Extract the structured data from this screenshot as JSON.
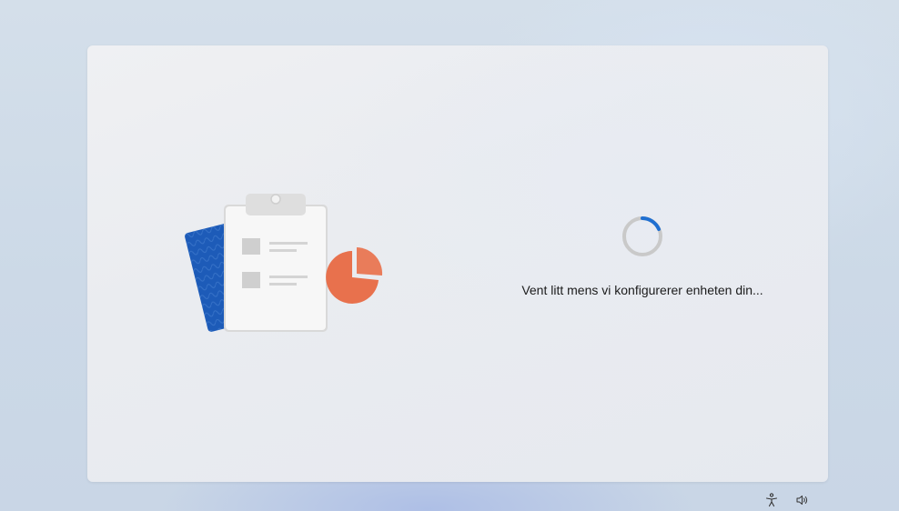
{
  "setup": {
    "status_message": "Vent litt mens vi konfigurerer enheten din..."
  },
  "illustration": {
    "items": [
      "notebook-icon",
      "clipboard-checklist-icon",
      "pie-chart-icon"
    ]
  },
  "taskbar": {
    "icons": [
      "accessibility-icon",
      "volume-icon"
    ]
  },
  "colors": {
    "accent_blue": "#1f6fd1",
    "notebook_blue": "#1d5bb8",
    "pie_orange": "#e8714d",
    "spinner_track": "#c9c9c9",
    "text": "#1b1b1b"
  }
}
